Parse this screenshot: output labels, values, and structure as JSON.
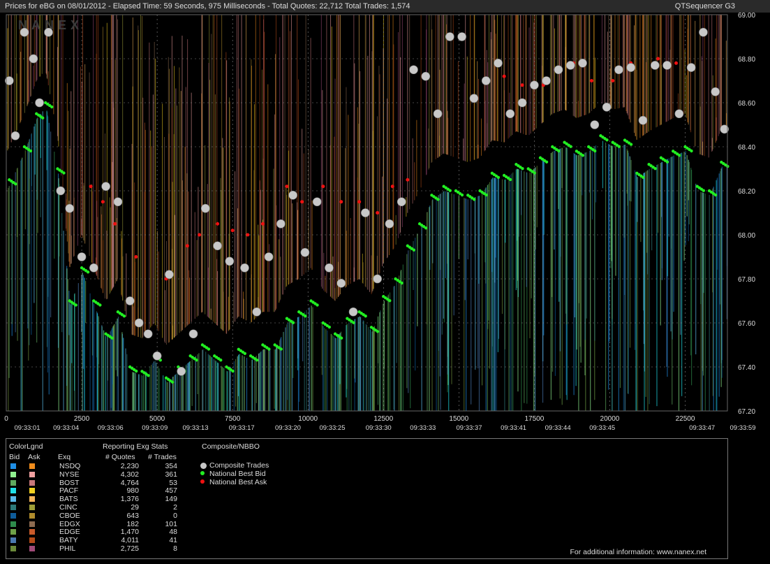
{
  "header": {
    "title": "Prices for  eBG  on  08/01/2012  -  Elapsed Time: 59 Seconds, 975 Milliseconds  -  Total Quotes: 22,712  Total Trades: 1,574",
    "app_name": "QTSequencer G3"
  },
  "watermark": "NANEX",
  "colors": {
    "background": "#000000",
    "composite_trades": "#c8c8c8",
    "national_best_bid": "#22ee22",
    "national_best_ask": "#ee1111",
    "panel_bg": "#2a2a2a"
  },
  "chart_data": {
    "type": "scatter",
    "title": "Prices for eBG on 08/01/2012",
    "ylim": [
      67.2,
      69.0
    ],
    "xlim": [
      0,
      23900
    ],
    "grid": true,
    "y_ticks": [
      "69.00",
      "68.80",
      "68.60",
      "68.40",
      "68.20",
      "68.00",
      "67.80",
      "67.60",
      "67.40",
      "67.20"
    ],
    "x_ticks": [
      "0",
      "2500",
      "5000",
      "7500",
      "10000",
      "12500",
      "15000",
      "17500",
      "20000",
      "22500"
    ],
    "time_labels": [
      {
        "seq": 0,
        "label": "09:33:01"
      },
      {
        "seq": 2100,
        "label": "09:33:04"
      },
      {
        "seq": 4500,
        "label": "09:33:06"
      },
      {
        "seq": 6900,
        "label": "09:33:09"
      },
      {
        "seq": 9100,
        "label": "09:33:13"
      },
      {
        "seq": 11600,
        "label": "09:33:17"
      },
      {
        "seq": 14100,
        "label": "09:33:20"
      },
      {
        "seq": 16500,
        "label": "09:33:25"
      },
      {
        "seq": 19000,
        "label": "09:33:30"
      },
      {
        "seq": 21400,
        "label": "09:33:33"
      },
      {
        "seq": 23900,
        "label": "09:33:37"
      },
      {
        "seq": 26300,
        "label": "09:33:41"
      },
      {
        "seq": 28700,
        "label": "09:33:44"
      },
      {
        "seq": 31100,
        "label": "09:33:45"
      },
      {
        "seq": 36500,
        "label": "09:33:47"
      },
      {
        "seq": 38700,
        "label": "09:33:59"
      }
    ],
    "series": [
      {
        "name": "Composite Trades",
        "color": "#c8c8c8",
        "points": [
          [
            100,
            68.7
          ],
          [
            300,
            68.45
          ],
          [
            600,
            68.92
          ],
          [
            900,
            68.8
          ],
          [
            1100,
            68.6
          ],
          [
            1400,
            68.92
          ],
          [
            1800,
            68.2
          ],
          [
            2100,
            68.12
          ],
          [
            2500,
            67.9
          ],
          [
            2900,
            67.85
          ],
          [
            3300,
            68.22
          ],
          [
            3700,
            68.15
          ],
          [
            4100,
            67.7
          ],
          [
            4400,
            67.6
          ],
          [
            4700,
            67.55
          ],
          [
            5000,
            67.45
          ],
          [
            5400,
            67.82
          ],
          [
            5800,
            67.38
          ],
          [
            6200,
            67.55
          ],
          [
            6600,
            68.12
          ],
          [
            7000,
            67.95
          ],
          [
            7400,
            67.88
          ],
          [
            7900,
            67.85
          ],
          [
            8300,
            67.65
          ],
          [
            8700,
            67.9
          ],
          [
            9100,
            68.05
          ],
          [
            9500,
            68.18
          ],
          [
            9900,
            67.92
          ],
          [
            10300,
            68.15
          ],
          [
            10700,
            67.85
          ],
          [
            11100,
            67.78
          ],
          [
            11500,
            67.65
          ],
          [
            11900,
            68.1
          ],
          [
            12300,
            67.8
          ],
          [
            12700,
            68.05
          ],
          [
            13100,
            68.15
          ],
          [
            13500,
            68.75
          ],
          [
            13900,
            68.72
          ],
          [
            14300,
            68.55
          ],
          [
            14700,
            68.9
          ],
          [
            15100,
            68.9
          ],
          [
            15500,
            68.62
          ],
          [
            15900,
            68.7
          ],
          [
            16300,
            68.78
          ],
          [
            16700,
            68.55
          ],
          [
            17100,
            68.6
          ],
          [
            17500,
            68.68
          ],
          [
            17900,
            68.7
          ],
          [
            18300,
            68.75
          ],
          [
            18700,
            68.77
          ],
          [
            19100,
            68.78
          ],
          [
            19500,
            68.5
          ],
          [
            19900,
            68.58
          ],
          [
            20300,
            68.75
          ],
          [
            20700,
            68.76
          ],
          [
            21100,
            68.52
          ],
          [
            21500,
            68.77
          ],
          [
            21900,
            68.77
          ],
          [
            22300,
            68.55
          ],
          [
            22700,
            68.76
          ],
          [
            23100,
            68.92
          ],
          [
            23500,
            68.65
          ],
          [
            23800,
            68.48
          ]
        ]
      },
      {
        "name": "National Best Bid",
        "color": "#22ee22",
        "points": [
          [
            100,
            68.25
          ],
          [
            600,
            68.4
          ],
          [
            1000,
            68.55
          ],
          [
            1300,
            68.6
          ],
          [
            1700,
            68.3
          ],
          [
            2100,
            67.7
          ],
          [
            2500,
            67.85
          ],
          [
            2900,
            67.7
          ],
          [
            3300,
            67.55
          ],
          [
            3700,
            67.65
          ],
          [
            4100,
            67.4
          ],
          [
            4500,
            67.38
          ],
          [
            4900,
            67.45
          ],
          [
            5300,
            67.35
          ],
          [
            5700,
            67.4
          ],
          [
            6100,
            67.45
          ],
          [
            6500,
            67.5
          ],
          [
            6900,
            67.45
          ],
          [
            7300,
            67.4
          ],
          [
            7700,
            67.48
          ],
          [
            8100,
            67.45
          ],
          [
            8500,
            67.5
          ],
          [
            8900,
            67.5
          ],
          [
            9300,
            67.62
          ],
          [
            9700,
            67.65
          ],
          [
            10100,
            67.7
          ],
          [
            10500,
            67.6
          ],
          [
            10900,
            67.55
          ],
          [
            11300,
            67.62
          ],
          [
            11700,
            67.65
          ],
          [
            12100,
            67.58
          ],
          [
            12500,
            67.72
          ],
          [
            12900,
            67.8
          ],
          [
            13300,
            67.95
          ],
          [
            13700,
            68.05
          ],
          [
            14100,
            68.18
          ],
          [
            14500,
            68.22
          ],
          [
            14900,
            68.2
          ],
          [
            15300,
            68.18
          ],
          [
            15700,
            68.2
          ],
          [
            16100,
            68.28
          ],
          [
            16500,
            68.27
          ],
          [
            16900,
            68.32
          ],
          [
            17300,
            68.3
          ],
          [
            17700,
            68.35
          ],
          [
            18100,
            68.4
          ],
          [
            18500,
            68.42
          ],
          [
            18900,
            68.38
          ],
          [
            19300,
            68.4
          ],
          [
            19700,
            68.45
          ],
          [
            20100,
            68.42
          ],
          [
            20500,
            68.43
          ],
          [
            20900,
            68.28
          ],
          [
            21300,
            68.32
          ],
          [
            21700,
            68.35
          ],
          [
            22100,
            68.38
          ],
          [
            22500,
            68.4
          ],
          [
            22900,
            68.22
          ],
          [
            23300,
            68.2
          ],
          [
            23700,
            68.33
          ]
        ]
      },
      {
        "name": "National Best Ask",
        "color": "#ee1111",
        "points": [
          [
            2800,
            68.22
          ],
          [
            3200,
            68.15
          ],
          [
            3600,
            68.05
          ],
          [
            4300,
            67.9
          ],
          [
            5300,
            67.8
          ],
          [
            6000,
            67.95
          ],
          [
            6400,
            68.0
          ],
          [
            7000,
            68.05
          ],
          [
            7500,
            68.02
          ],
          [
            8000,
            68.0
          ],
          [
            8500,
            68.05
          ],
          [
            9300,
            68.22
          ],
          [
            9800,
            68.15
          ],
          [
            10500,
            68.22
          ],
          [
            11100,
            68.15
          ],
          [
            11700,
            68.15
          ],
          [
            12300,
            68.1
          ],
          [
            12800,
            68.22
          ],
          [
            13300,
            68.25
          ],
          [
            16500,
            68.72
          ],
          [
            17100,
            68.68
          ],
          [
            17800,
            68.68
          ],
          [
            18800,
            68.78
          ],
          [
            19400,
            68.7
          ],
          [
            20100,
            68.7
          ],
          [
            20700,
            68.78
          ],
          [
            21600,
            68.8
          ],
          [
            22200,
            68.78
          ]
        ]
      }
    ]
  },
  "legend": {
    "color_legend_title": "ColorLgnd",
    "bid_label": "Bid",
    "ask_label": "Ask",
    "exq_label": "Exq",
    "stats_title": "Reporting Exg Stats",
    "quotes_header": "# Quotes",
    "trades_header": "# Trades",
    "composite_title": "Composite/NBBO",
    "composite_items": [
      {
        "label": "Composite Trades",
        "color": "#c8c8c8"
      },
      {
        "label": "National Best Bid",
        "color": "#22ee22"
      },
      {
        "label": "National Best Ask",
        "color": "#ee1111"
      }
    ],
    "exchanges": [
      {
        "name": "NSDQ",
        "quotes": "2,230",
        "trades": "354",
        "bid_color": "#1f8fe6",
        "ask_color": "#f08c1c"
      },
      {
        "name": "NYSE",
        "quotes": "4,302",
        "trades": "361",
        "bid_color": "#8ff08f",
        "ask_color": "#f0a0a0"
      },
      {
        "name": "BOST",
        "quotes": "4,764",
        "trades": "53",
        "bid_color": "#5fa95f",
        "ask_color": "#c8777a"
      },
      {
        "name": "PACF",
        "quotes": "980",
        "trades": "457",
        "bid_color": "#1fe0e8",
        "ask_color": "#f0d020"
      },
      {
        "name": "BATS",
        "quotes": "1,376",
        "trades": "149",
        "bid_color": "#5abaea",
        "ask_color": "#f4b45a"
      },
      {
        "name": "CINC",
        "quotes": "29",
        "trades": "2",
        "bid_color": "#2d7a7a",
        "ask_color": "#9e9e38"
      },
      {
        "name": "CBOE",
        "quotes": "643",
        "trades": "0",
        "bid_color": "#0e5c9a",
        "ask_color": "#b08c2c"
      },
      {
        "name": "EDGX",
        "quotes": "182",
        "trades": "101",
        "bid_color": "#2e8c4c",
        "ask_color": "#8c6a50"
      },
      {
        "name": "EDGE",
        "quotes": "1,470",
        "trades": "48",
        "bid_color": "#6ea048",
        "ask_color": "#c85a2a"
      },
      {
        "name": "BATY",
        "quotes": "4,011",
        "trades": "41",
        "bid_color": "#4a78b0",
        "ask_color": "#b44a18"
      },
      {
        "name": "PHIL",
        "quotes": "2,725",
        "trades": "8",
        "bid_color": "#6b8a3a",
        "ask_color": "#a04a78"
      }
    ],
    "footer": "For additional information: www.nanex.net"
  }
}
